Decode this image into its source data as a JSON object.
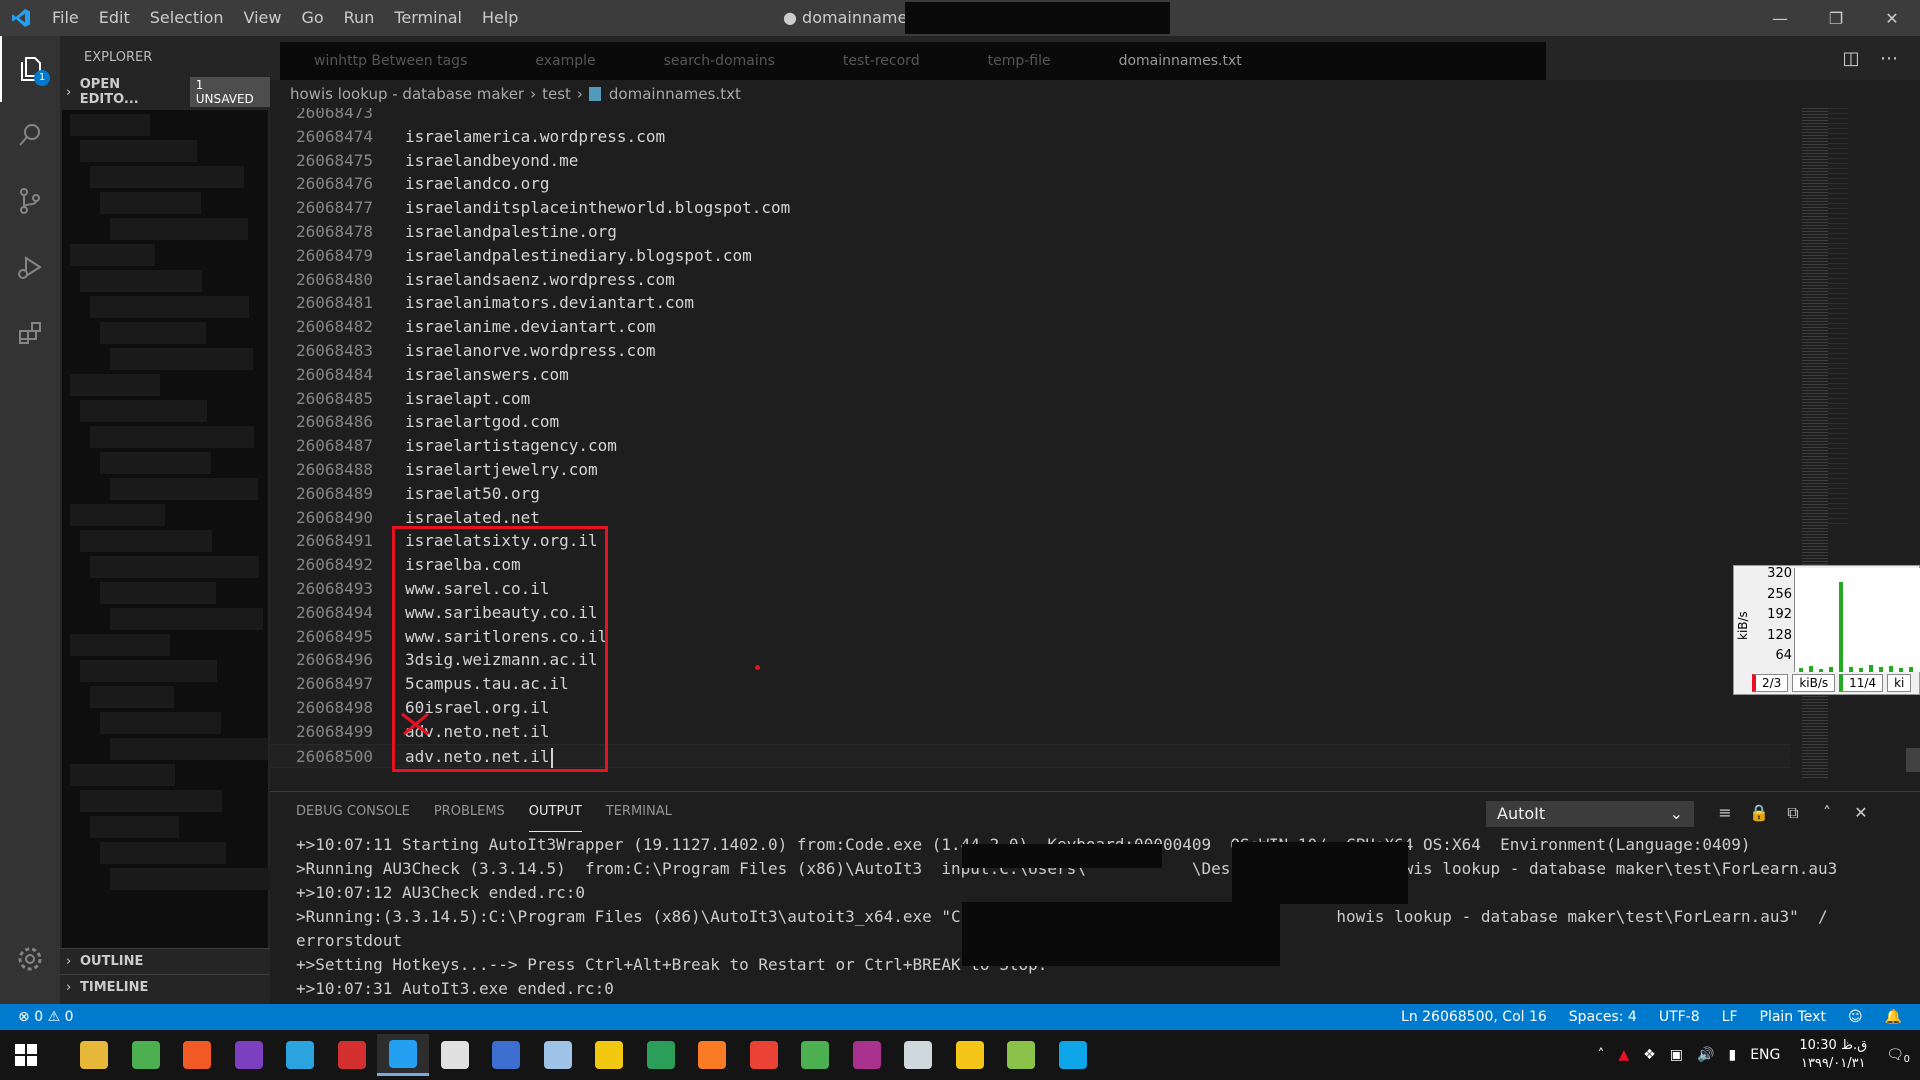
{
  "titlebar": {
    "menu": [
      "File",
      "Edit",
      "Selection",
      "View",
      "Go",
      "Run",
      "Terminal",
      "Help"
    ],
    "title": "● domainnames.txt"
  },
  "activitybar": {
    "explorer_badge": "1"
  },
  "sidebar": {
    "header": "EXPLORER",
    "open_editors": "OPEN EDITO...",
    "unsaved_badge": "1 UNSAVED",
    "outline": "OUTLINE",
    "timeline": "TIMELINE"
  },
  "tabbar": {
    "tabs": [
      "winhttp Between tags",
      "example",
      "search-domains",
      "test-record",
      "temp-file",
      "domainnames.txt"
    ]
  },
  "breadcrumb": {
    "folder": "howis lookup - database maker",
    "subfolder": "test",
    "file": "domainnames.txt"
  },
  "editor": {
    "lines": [
      {
        "n": "26068473",
        "t": ""
      },
      {
        "n": "26068474",
        "t": "israelamerica.wordpress.com"
      },
      {
        "n": "26068475",
        "t": "israelandbeyond.me"
      },
      {
        "n": "26068476",
        "t": "israelandco.org"
      },
      {
        "n": "26068477",
        "t": "israelanditsplaceintheworld.blogspot.com"
      },
      {
        "n": "26068478",
        "t": "israelandpalestine.org"
      },
      {
        "n": "26068479",
        "t": "israelandpalestinediary.blogspot.com"
      },
      {
        "n": "26068480",
        "t": "israelandsaenz.wordpress.com"
      },
      {
        "n": "26068481",
        "t": "israelanimators.deviantart.com"
      },
      {
        "n": "26068482",
        "t": "israelanime.deviantart.com"
      },
      {
        "n": "26068483",
        "t": "israelanorve.wordpress.com"
      },
      {
        "n": "26068484",
        "t": "israelanswers.com"
      },
      {
        "n": "26068485",
        "t": "israelapt.com"
      },
      {
        "n": "26068486",
        "t": "israelartgod.com"
      },
      {
        "n": "26068487",
        "t": "israelartistagency.com"
      },
      {
        "n": "26068488",
        "t": "israelartjewelry.com"
      },
      {
        "n": "26068489",
        "t": "israelat50.org"
      },
      {
        "n": "26068490",
        "t": "israelated.net"
      },
      {
        "n": "26068491",
        "t": "israelatsixty.org.il"
      },
      {
        "n": "26068492",
        "t": "israelba.com"
      },
      {
        "n": "26068493",
        "t": "www.sarel.co.il"
      },
      {
        "n": "26068494",
        "t": "www.saribeauty.co.il"
      },
      {
        "n": "26068495",
        "t": "www.saritlorens.co.il"
      },
      {
        "n": "26068496",
        "t": "3dsig.weizmann.ac.il"
      },
      {
        "n": "26068497",
        "t": "5campus.tau.ac.il"
      },
      {
        "n": "26068498",
        "t": "60israel.org.il"
      },
      {
        "n": "26068499",
        "t": "adv.neto.net.il"
      },
      {
        "n": "26068500",
        "t": "adv.neto.net.il"
      }
    ]
  },
  "netmeter": {
    "unit_label": "kiB/s",
    "ticks": [
      "320",
      "256",
      "192",
      "128",
      "64"
    ],
    "levels": [
      0.04,
      0.06,
      0.03,
      0.05,
      0.9,
      0.05,
      0.04,
      0.07,
      0.05,
      0.06,
      0.04,
      0.05
    ],
    "footer": [
      "2/3",
      "kiB/s",
      "11/4",
      "ki"
    ]
  },
  "panel": {
    "tabs": [
      "DEBUG CONSOLE",
      "PROBLEMS",
      "OUTPUT",
      "TERMINAL"
    ],
    "select_value": "AutoIt",
    "output": [
      "+>10:07:11 Starting AutoIt3Wrapper (19.1127.1402.0) from:Code.exe (1.44.2.0)  Keyboard:00000409  OS:WIN_10/  CPU:X64 OS:X64  Environment(Language:0409)",
      ">Running AU3Check (3.3.14.5)  from:C:\\Program Files (x86)\\AutoIt3  input:C:\\Users\\           \\Desktop\\           howis lookup - database maker\\test\\ForLearn.au3",
      "+>10:07:12 AU3Check ended.rc:0",
      ">Running:(3.3.14.5):C:\\Program Files (x86)\\AutoIt3\\autoit3_x64.exe \"C:\\Users\\           \\Desktop\\           howis lookup - database maker\\test\\ForLearn.au3\"  /",
      "errorstdout",
      "+>Setting Hotkeys...--> Press Ctrl+Alt+Break to Restart or Ctrl+BREAK to Stop.",
      "+>10:07:31 AutoIt3.exe ended.rc:0"
    ]
  },
  "statusbar": {
    "errors": "0",
    "warnings": "0",
    "position": "Ln 26068500, Col 16",
    "spaces": "Spaces: 4",
    "encoding": "UTF-8",
    "eol": "LF",
    "language": "Plain Text"
  },
  "taskbar": {
    "lang": "ENG",
    "time": "10:30 ق.ظ",
    "date": "۱۳۹۹/۰۱/۳۱",
    "notif_count": "0",
    "apps": [
      {
        "name": "file-explorer",
        "color": "#e8b83a"
      },
      {
        "name": "chrome",
        "color": "#4caf50"
      },
      {
        "name": "brave",
        "color": "#f15a24"
      },
      {
        "name": "app-purple",
        "color": "#7b3fbf"
      },
      {
        "name": "telegram",
        "color": "#2aa3df"
      },
      {
        "name": "app-green-red",
        "color": "#d32f2f"
      },
      {
        "name": "vscode",
        "color": "#23a0f2"
      },
      {
        "name": "xampp-x",
        "color": "#e0e0e0"
      },
      {
        "name": "app-blue",
        "color": "#3d6fd1"
      },
      {
        "name": "app-book",
        "color": "#9fc3e7"
      },
      {
        "name": "app-chart",
        "color": "#f2c811"
      },
      {
        "name": "edge",
        "color": "#2b9f5a"
      },
      {
        "name": "xampp",
        "color": "#fb7a24"
      },
      {
        "name": "chrome-2",
        "color": "#ea4335"
      },
      {
        "name": "utorrent",
        "color": "#4caf50"
      },
      {
        "name": "winrar",
        "color": "#a8328e"
      },
      {
        "name": "app-window",
        "color": "#cfd8dc"
      },
      {
        "name": "help",
        "color": "#f5c518"
      },
      {
        "name": "app-notepad",
        "color": "#8bc34a"
      },
      {
        "name": "app-screens",
        "color": "#0ea5e9"
      }
    ]
  }
}
